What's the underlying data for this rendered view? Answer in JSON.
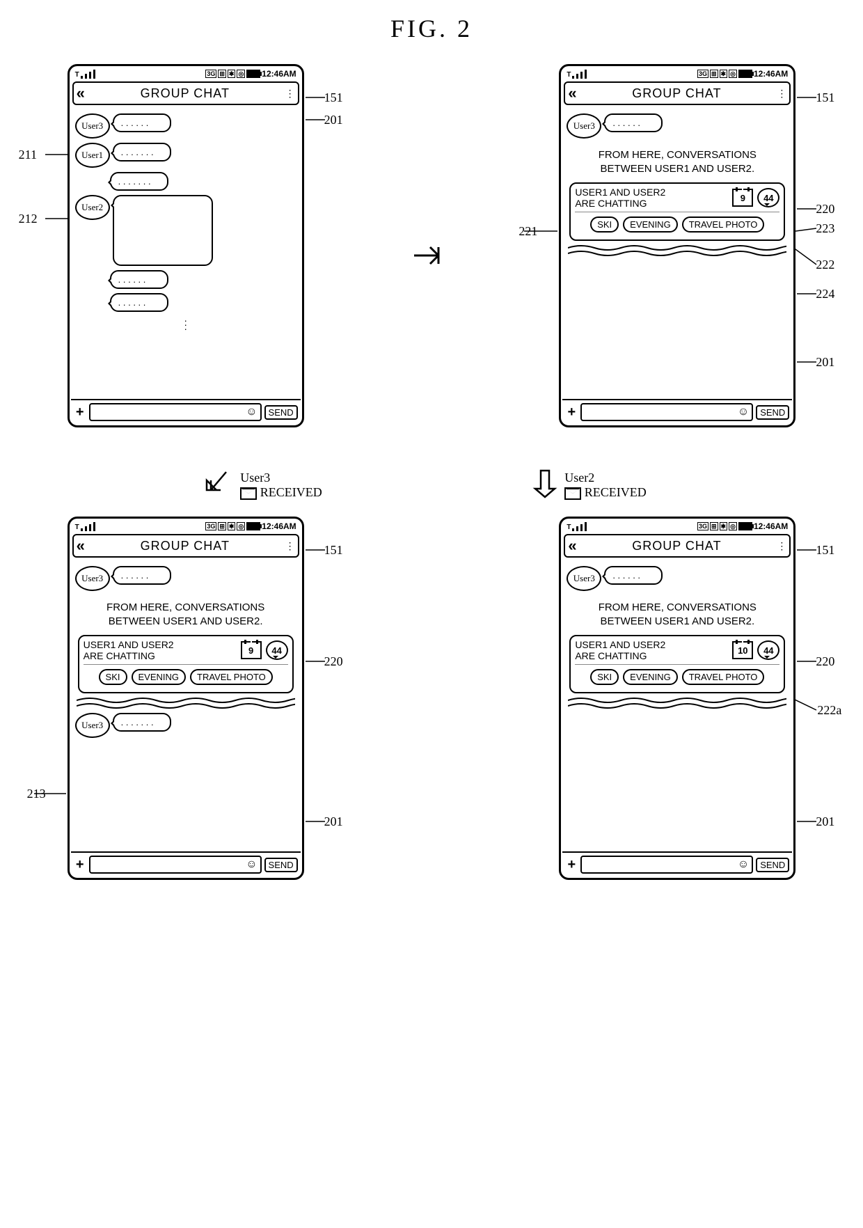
{
  "figure_title": "FIG. 2",
  "status": {
    "time": "12:46AM",
    "icons": [
      "3G",
      "⊞",
      "✱",
      "◎"
    ]
  },
  "titlebar": {
    "title": "GROUP CHAT"
  },
  "users": {
    "u1": "User1",
    "u2": "User2",
    "u3": "User3"
  },
  "bubble_dots_short": ". . . .  . .",
  "bubble_dots_long": ". . . . . . .",
  "banner": {
    "line1": "FROM HERE, CONVERSATIONS",
    "line2": "BETWEEN USER1 AND USER2."
  },
  "summary": {
    "text_line1": "USER1 AND USER2",
    "text_line2": "ARE CHATTING",
    "calendar_num_a": "9",
    "calendar_num_b": "10",
    "count": "44"
  },
  "tags": {
    "t1": "SKI",
    "t2": "EVENING",
    "t3": "TRAVEL PHOTO"
  },
  "input": {
    "send": "SEND"
  },
  "mid": {
    "user3_label": "User3",
    "user2_label": "User2",
    "received": "RECEIVED"
  },
  "callouts": {
    "c151": "151",
    "c201": "201",
    "c211": "211",
    "c212": "212",
    "c213": "213",
    "c220": "220",
    "c221": "221",
    "c222": "222",
    "c222a": "222a",
    "c223": "223",
    "c224": "224"
  }
}
